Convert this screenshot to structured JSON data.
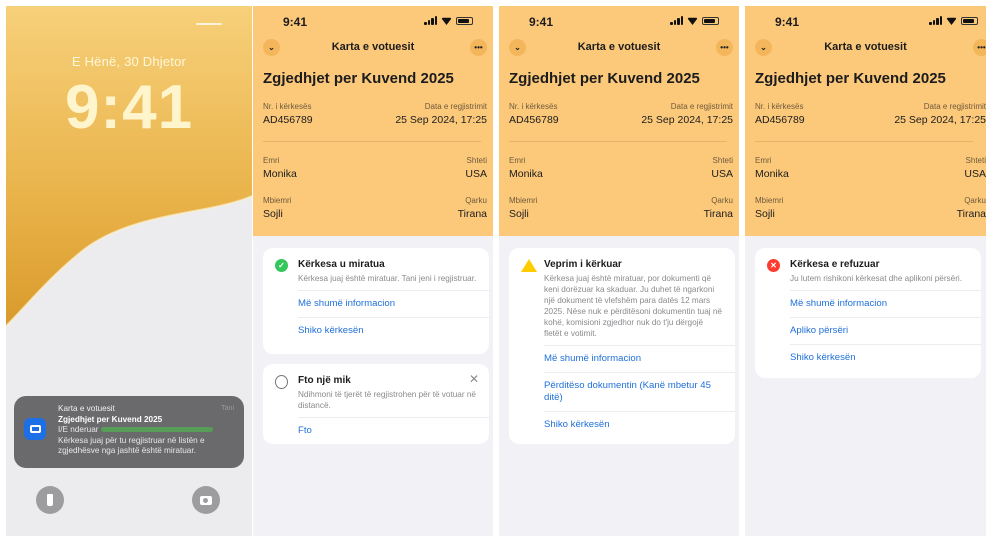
{
  "lock": {
    "date": "E Hënë, 30 Dhjetor",
    "time": "9:41",
    "notification": {
      "app": "Karta e votuesit",
      "title": "Zgjedhjet per Kuvend 2025",
      "line1": "I/E nderuar",
      "line2": "Kërkesa juaj për tu regjistruar në listën e",
      "line3": "zgjedhësve nga jashtë është miratuar.",
      "time": "Tani"
    }
  },
  "status_time": "9:41",
  "nav_title": "Karta e votuesit",
  "page_title": "Zgjedhjet per Kuvend 2025",
  "labels": {
    "request_no": "Nr. i kërkesës",
    "reg_date": "Data e regjistrimit",
    "first_name": "Emri",
    "country": "Shteti",
    "last_name": "Mbiemri",
    "district": "Qarku"
  },
  "values": {
    "request_no": "AD456789",
    "reg_date": "25 Sep 2024, 17:25",
    "first_name": "Monika",
    "country": "USA",
    "last_name": "Sojli",
    "district": "Tirana"
  },
  "approved_card": {
    "title": "Kërkesa u miratua",
    "desc": "Kërkesa juaj është miratuar. Tani jeni i regjistruar.",
    "link1": "Më shumë informacion",
    "link2": "Shiko kërkesën"
  },
  "invite_card": {
    "title": "Fto një mik",
    "desc": "Ndihmoni të tjerët të regjistrohen për të votuar në distancë.",
    "link": "Fto"
  },
  "action_card": {
    "title": "Veprim i kërkuar",
    "desc": "Kërkesa juaj është miratuar, por dokumenti që keni dorëzuar ka skaduar. Ju duhet të ngarkoni një dokument të vlefshëm para datës 12 mars 2025. Nëse nuk e përditësoni dokumentin tuaj në kohë, komisioni zgjedhor nuk do t'ju dërgojë fletët e votimit.",
    "link1": "Më shumë informacion",
    "link2": "Përditëso dokumentin (Kanë mbetur 45 ditë)",
    "link3": "Shiko kërkesën"
  },
  "rejected_card": {
    "title": "Kërkesa e refuzuar",
    "desc": "Ju lutem rishikoni kërkesat dhe aplikoni përsëri.",
    "link1": "Më shumë informacion",
    "link2": "Apliko përsëri",
    "link3": "Shiko kërkesën"
  },
  "colors": {
    "header": "#fcc97a",
    "link": "#1e6fd9",
    "success": "#34c759",
    "warning": "#ffcc00",
    "error": "#ff3b30"
  },
  "icons": [
    "chevron-down-icon",
    "more-icon",
    "check-icon",
    "warning-icon",
    "error-icon",
    "invite-icon",
    "close-icon",
    "flashlight-icon",
    "camera-icon",
    "wallet-card-icon"
  ]
}
